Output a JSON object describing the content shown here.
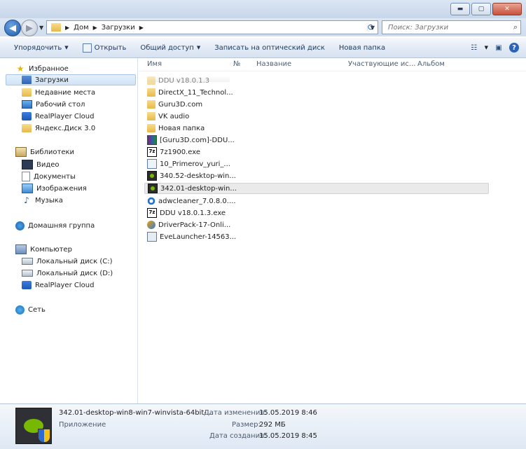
{
  "window": {
    "controls": {
      "minimize": "▬",
      "maximize": "▢",
      "close": "✕"
    }
  },
  "address": {
    "crumbs": [
      "Дом",
      "Загрузки"
    ],
    "search_placeholder": "Поиск: Загрузки"
  },
  "toolbar": {
    "organize": "Упорядочить",
    "open": "Открыть",
    "share": "Общий доступ",
    "burn": "Записать на оптический диск",
    "new_folder": "Новая папка"
  },
  "nav": {
    "favorites": {
      "title": "Избранное",
      "items": [
        "Загрузки",
        "Недавние места",
        "Рабочий стол",
        "RealPlayer Cloud",
        "Яндекс.Диск 3.0"
      ]
    },
    "libraries": {
      "title": "Библиотеки",
      "items": [
        "Видео",
        "Документы",
        "Изображения",
        "Музыка"
      ]
    },
    "homegroup": "Домашняя группа",
    "computer": {
      "title": "Компьютер",
      "items": [
        "Локальный диск (C:)",
        "Локальный диск (D:)",
        "RealPlayer Cloud"
      ]
    },
    "network": "Сеть"
  },
  "columns": {
    "name": "Имя",
    "number": "№",
    "title": "Название",
    "artists": "Участвующие ис...",
    "album": "Альбом"
  },
  "files": [
    {
      "name": "DDU v18.0.1.3",
      "icon": "folder"
    },
    {
      "name": "DirectX_11_Technol...",
      "icon": "folder"
    },
    {
      "name": "Guru3D.com",
      "icon": "folder"
    },
    {
      "name": "VK audio",
      "icon": "folder"
    },
    {
      "name": "Новая папка",
      "icon": "folder"
    },
    {
      "name": "[Guru3D.com]-DDU...",
      "icon": "rar"
    },
    {
      "name": "7z1900.exe",
      "icon": "7z"
    },
    {
      "name": "10_Primerov_yuri_...",
      "icon": "app"
    },
    {
      "name": "340.52-desktop-win...",
      "icon": "nvidia"
    },
    {
      "name": "342.01-desktop-win...",
      "icon": "nvidia"
    },
    {
      "name": "adwcleaner_7.0.8.0....",
      "icon": "adw"
    },
    {
      "name": "DDU v18.0.1.3.exe",
      "icon": "7z"
    },
    {
      "name": "DriverPack-17-Onli...",
      "icon": "driverpack"
    },
    {
      "name": "EveLauncher-14563...",
      "icon": "eve"
    }
  ],
  "selected_index": 9,
  "details": {
    "name": "342.01-desktop-win8-win7-winvista-64bit-...",
    "type": "Приложение",
    "modified_label": "Дата изменения:",
    "modified": "15.05.2019 8:46",
    "size_label": "Размер:",
    "size": "292 МБ",
    "created_label": "Дата создания:",
    "created": "15.05.2019 8:45"
  }
}
